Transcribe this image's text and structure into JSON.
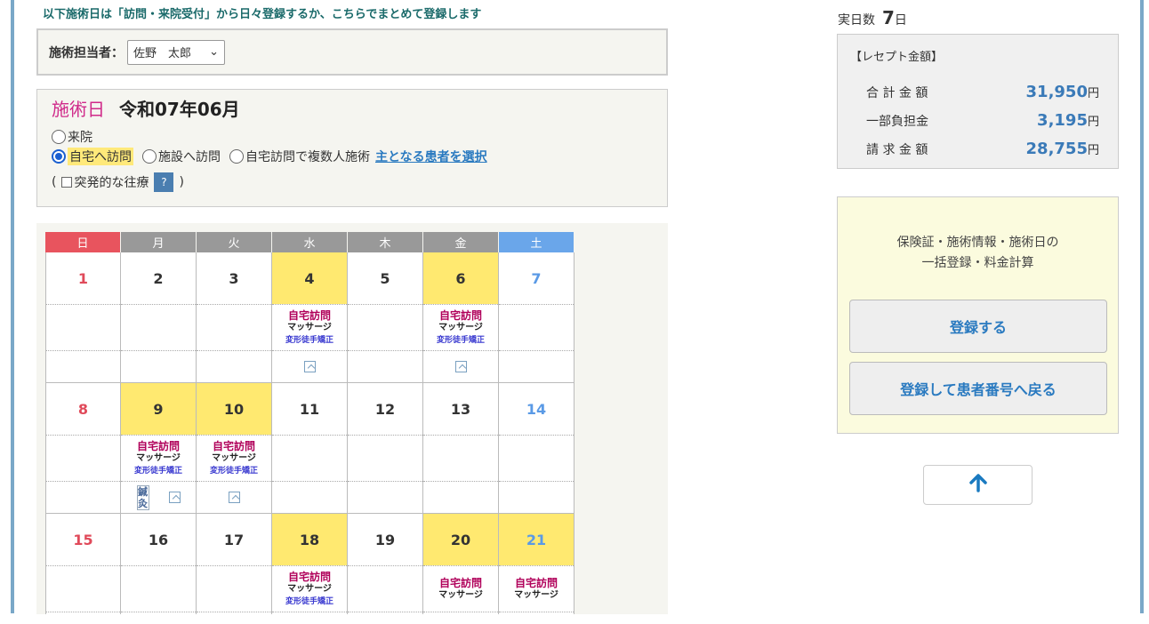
{
  "notice": "以下施術日は「訪問・来院受付」から日々登録するか、こちらでまとめて登録します",
  "staff": {
    "label": "施術担当者：",
    "selected": "佐野　太郎"
  },
  "date": {
    "title": "施術日",
    "month": "令和07年06月"
  },
  "radios": {
    "raiin": "来院",
    "jitaku": "自宅へ訪問",
    "shisetsu": "施設へ訪問",
    "fukusu": "自宅訪問で複数人施術",
    "select_link": "主となる患者を選択"
  },
  "sudden": {
    "open": "(",
    "label": "突発的な往療",
    "help": "?",
    "close": ")"
  },
  "weekdays": [
    "日",
    "月",
    "火",
    "水",
    "木",
    "金",
    "土"
  ],
  "visit": {
    "type": "自宅訪問",
    "massage": "マッサージ",
    "correction": "変形徒手矯正",
    "acu1": "鍼",
    "acu2": "灸"
  },
  "summary": {
    "days_label": "実日数",
    "days_value": "7",
    "days_unit": "日",
    "receipt_title": "【レセプト金額】",
    "total_label": "合 計 金 額",
    "total_value": "31,950",
    "copay_label": "一部負担金",
    "copay_value": "3,195",
    "claim_label": "請 求 金 額",
    "claim_value": "28,755",
    "yen": "円"
  },
  "register": {
    "desc1": "保険証・施術情報・施術日の",
    "desc2": "一括登録・料金計算",
    "btn1": "登録する",
    "btn2": "登録して患者番号へ戻る"
  },
  "up_icon": "arrow-up-icon",
  "up_glyph": "🡡"
}
